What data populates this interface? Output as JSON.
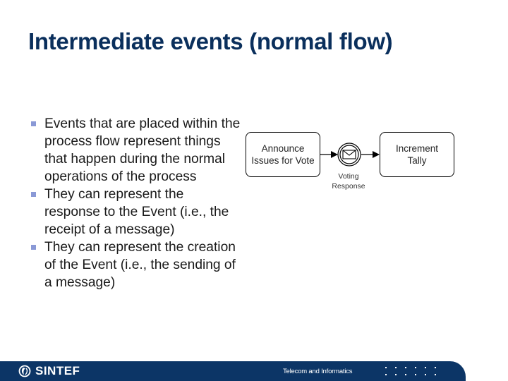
{
  "slide": {
    "title": "Intermediate events (normal flow)",
    "bullets": [
      "Events that are placed within the process flow represent things that happen during the normal operations of the process",
      "They can represent the response to the Event (i.e., the receipt of a message)",
      "They can represent the creation of the Event (i.e., the sending of a message)"
    ]
  },
  "diagram": {
    "tasks": [
      {
        "label_line1": "Announce",
        "label_line2": "Issues for Vote"
      },
      {
        "label_line1": "Increment",
        "label_line2": "Tally"
      }
    ],
    "event": {
      "icon": "envelope-icon",
      "type": "intermediate-message-event",
      "label_line1": "Voting",
      "label_line2": "Response"
    }
  },
  "footer": {
    "logo_text": "SINTEF",
    "logo_icon": "sintef-logo-icon",
    "department": "Telecom and Informatics"
  },
  "colors": {
    "title": "#0a2f5c",
    "footer_bg": "#0c3566",
    "bullet": "#8a99d6"
  }
}
